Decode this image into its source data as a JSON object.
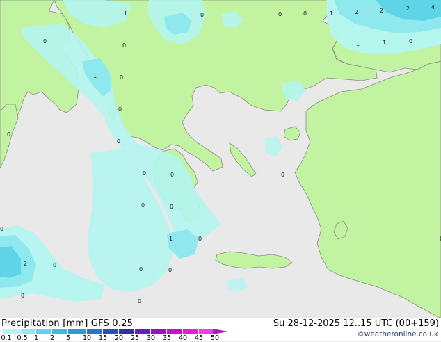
{
  "title": "Precipitation [mm]  GFS 0.25",
  "datetime": "Su 28-12-2025 12..15 UTC (00+159)",
  "copyright": "©weatheronline.co.uk",
  "colors": {
    "sea": "#e9e9e9",
    "land": "#c2f3a0",
    "coast": "#8a8a8a"
  },
  "legend": {
    "ticks": [
      "0.1",
      "0.5",
      "1",
      "2",
      "5",
      "10",
      "15",
      "20",
      "25",
      "30",
      "35",
      "40",
      "45",
      "50"
    ],
    "colors": [
      "#b4f5f0",
      "#8ee8ee",
      "#5fd4e6",
      "#3cbddf",
      "#2c9ad3",
      "#2a72c8",
      "#2c4db8",
      "#3130a8",
      "#6a1db8",
      "#9b0ec3",
      "#c90dcf",
      "#e71cd8",
      "#f33ce2",
      "#b31ab3"
    ]
  },
  "map_labels": [
    "1",
    "0",
    "0",
    "0",
    "1",
    "2",
    "2",
    "2",
    "4",
    "0",
    "0",
    "1",
    "1",
    "0",
    "1",
    "0",
    "0",
    "0",
    "0",
    "0",
    "0",
    "0",
    "0",
    "0",
    "0",
    "1",
    "0",
    "0",
    "2",
    "0",
    "0",
    "0",
    "0",
    "0"
  ]
}
